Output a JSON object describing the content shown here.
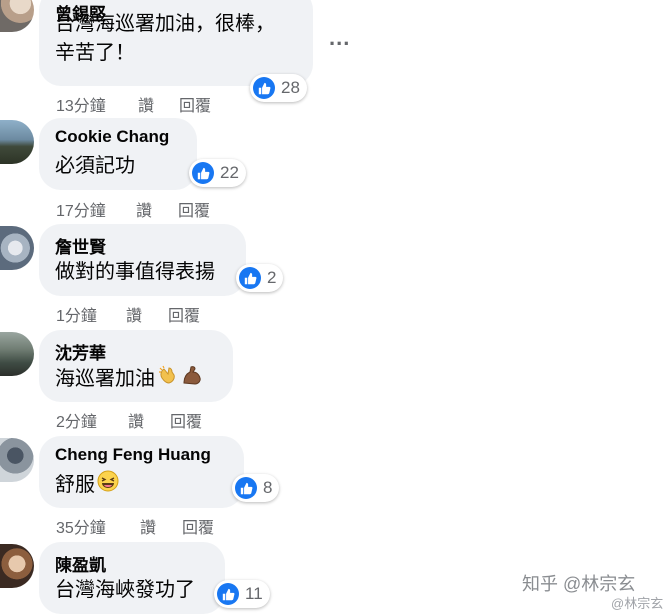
{
  "comments": [
    {
      "author": "曾錫堅",
      "lines": [
        "台灣海巡署加油，很棒，",
        "辛苦了！"
      ],
      "likes": "28",
      "time": "13分鐘",
      "like_label": "讚",
      "reply_label": "回覆"
    },
    {
      "author": "Cookie Chang",
      "lines": [
        "必須記功"
      ],
      "likes": "22",
      "time": "17分鐘",
      "like_label": "讚",
      "reply_label": "回覆"
    },
    {
      "author": "詹世賢",
      "lines": [
        "做對的事值得表揚"
      ],
      "likes": "2",
      "time": "1分鐘",
      "like_label": "讚",
      "reply_label": "回覆"
    },
    {
      "author": "沈芳華",
      "lines": [
        "海巡署加油"
      ],
      "emojis": [
        "clapping-hands-icon",
        "flexed-biceps-icon"
      ],
      "time": "2分鐘",
      "like_label": "讚",
      "reply_label": "回覆"
    },
    {
      "author": "Cheng Feng Huang",
      "lines": [
        "舒服"
      ],
      "emojis": [
        "grinning-squinting-face-icon"
      ],
      "likes": "8",
      "time": "35分鐘",
      "like_label": "讚",
      "reply_label": "回覆"
    },
    {
      "author": "陳盈凱",
      "lines": [
        "台灣海峽發功了"
      ],
      "likes": "11"
    }
  ],
  "more_options": "...",
  "watermark": {
    "main": "知乎 @林宗玄",
    "sub": "@林宗玄"
  },
  "colors": {
    "bubble": "#f0f2f5",
    "like_blue": "#1877f2",
    "meta_gray": "#65676b"
  }
}
